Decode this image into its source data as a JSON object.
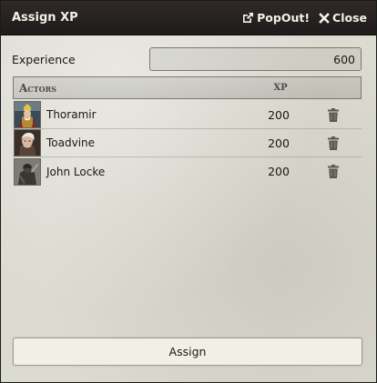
{
  "window": {
    "title": "Assign XP",
    "popout_label": "PopOut!",
    "close_label": "Close"
  },
  "experience": {
    "label": "Experience",
    "value": "600"
  },
  "table": {
    "header_actors": "Actors",
    "header_xp": "XP",
    "rows": [
      {
        "name": "Thoramir",
        "xp": "200"
      },
      {
        "name": "Toadvine",
        "xp": "200"
      },
      {
        "name": "John Locke",
        "xp": "200"
      }
    ]
  },
  "assign_label": "Assign",
  "icons": {
    "popout": "external-link-icon",
    "close": "x-icon",
    "delete": "trash-icon"
  }
}
